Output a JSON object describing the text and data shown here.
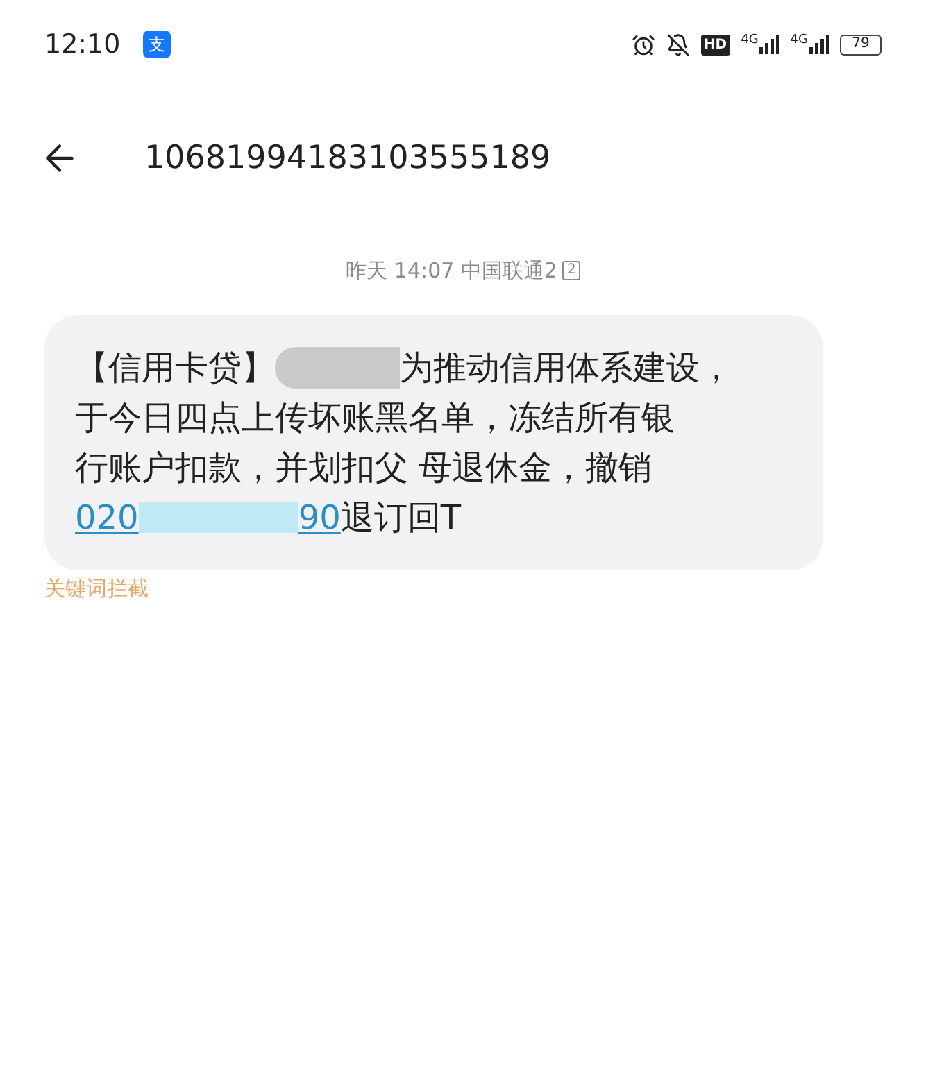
{
  "status_bar": {
    "time": "12:10",
    "app_badge": "支",
    "hd": "HD",
    "signals": [
      "4G",
      "4G"
    ],
    "battery": "79"
  },
  "header": {
    "title": "10681994183103555189"
  },
  "message": {
    "meta": "昨天 14:07 中国联通2",
    "sim": "2",
    "lines": [
      [
        {
          "kind": "text",
          "text": "【信用卡贷】"
        },
        {
          "kind": "redacted"
        },
        {
          "kind": "text",
          "text": "为推动信用体系建设，"
        }
      ],
      [
        {
          "kind": "text",
          "text": "于今日四点上传坏账黑名单，冻结所有银"
        }
      ],
      [
        {
          "kind": "text",
          "text": "行账户扣款，并划扣父 母退休金，撤销"
        }
      ],
      [
        {
          "kind": "link",
          "text": "020"
        },
        {
          "kind": "redacted_link"
        },
        {
          "kind": "link",
          "text": "90"
        },
        {
          "kind": "text",
          "text": "退订回T"
        }
      ]
    ],
    "note": "关键词拦截"
  }
}
